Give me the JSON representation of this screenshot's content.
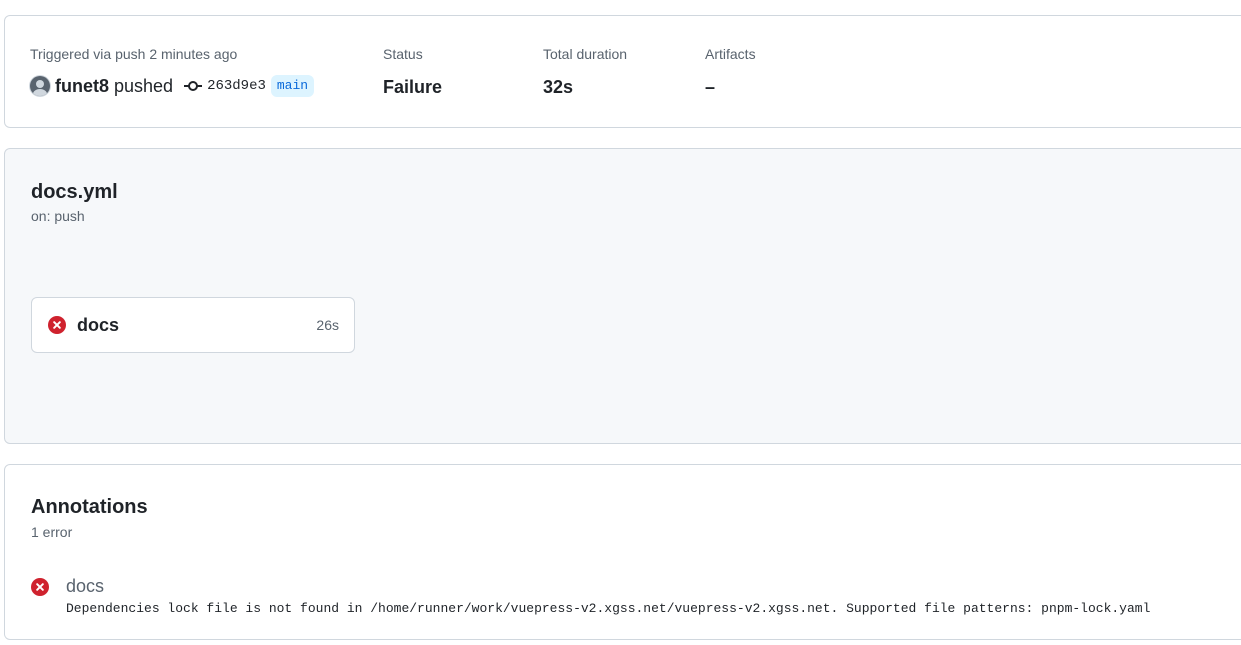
{
  "summary": {
    "trigger_label": "Triggered via push 2 minutes ago",
    "actor": "funet8",
    "action": "pushed",
    "commit_sha": "263d9e3",
    "branch": "main",
    "status_label": "Status",
    "status_value": "Failure",
    "duration_label": "Total duration",
    "duration_value": "32s",
    "artifacts_label": "Artifacts",
    "artifacts_value": "–"
  },
  "workflow": {
    "file_name": "docs.yml",
    "trigger": "on: push",
    "jobs": [
      {
        "name": "docs",
        "duration": "26s",
        "status": "failure",
        "icon": "x-circle-icon"
      }
    ]
  },
  "annotations": {
    "title": "Annotations",
    "count_text": "1 error",
    "items": [
      {
        "job": "docs",
        "message": "Dependencies lock file is not found in /home/runner/work/vuepress-v2.xgss.net/vuepress-v2.xgss.net. Supported file patterns: pnpm-lock.yaml",
        "icon": "x-circle-icon"
      }
    ]
  },
  "colors": {
    "failure": "#cf222e",
    "branch_bg": "#ddf4ff",
    "branch_text": "#0969da",
    "muted_text": "#59636e",
    "panel_bg": "#f6f8fa",
    "border": "#d0d7de"
  }
}
